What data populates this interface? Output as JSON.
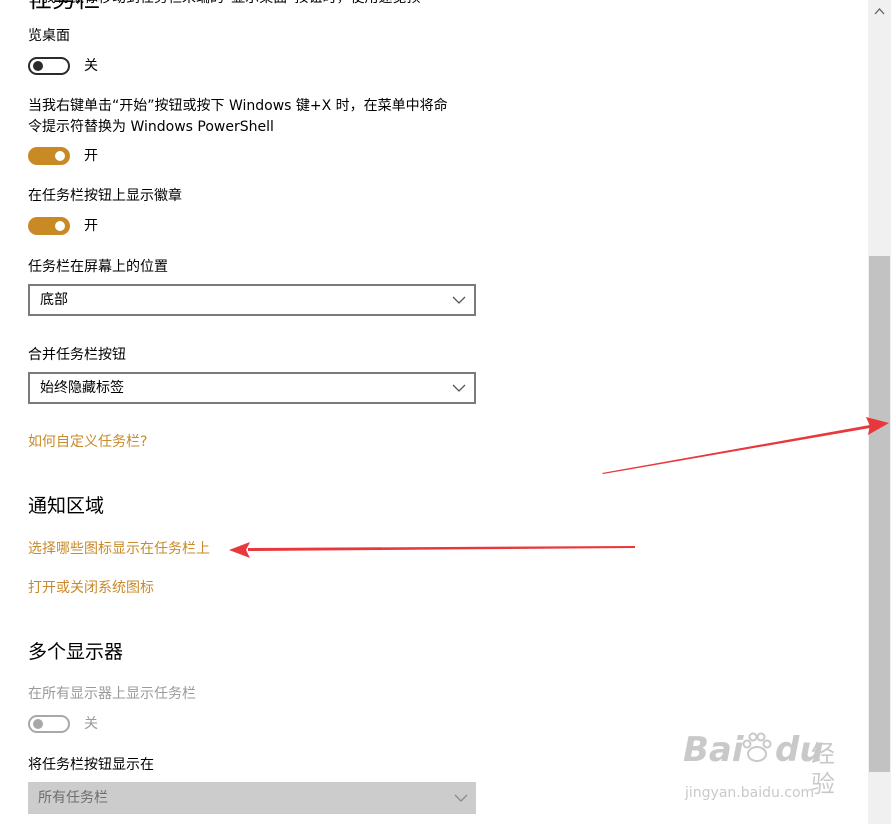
{
  "page": {
    "heading_partial": "任务栏",
    "clipped_line": "当我将鼠标移动到任务栏末端的“显示桌面”按钮时，使用速览预",
    "peek_desktop_label_tail": "览桌面"
  },
  "toggles": {
    "peek": {
      "state": "关"
    },
    "powershell": {
      "label_line1": "当我右键单击“开始”按钮或按下 Windows 键+X 时，在菜单中将命",
      "label_line2": "令提示符替换为 Windows PowerShell",
      "state": "开"
    },
    "badges": {
      "label": "在任务栏按钮上显示徽章",
      "state": "开"
    }
  },
  "position": {
    "label": "任务栏在屏幕上的位置",
    "value": "底部"
  },
  "combine": {
    "label": "合并任务栏按钮",
    "value": "始终隐藏标签"
  },
  "customize_link": "如何自定义任务栏?",
  "notification": {
    "title": "通知区域",
    "link1": "选择哪些图标显示在任务栏上",
    "link2": "打开或关闭系统图标"
  },
  "multi_display": {
    "title": "多个显示器",
    "show_all_label": "在所有显示器上显示任务栏",
    "show_all_state": "关",
    "buttons_label": "将任务栏按钮显示在",
    "buttons_value": "所有任务栏"
  },
  "watermark": {
    "brand": "Bai",
    "brand2": "du",
    "text_cn": "经验",
    "url": "jingyan.baidu.com"
  },
  "colors": {
    "accent": "#c98a26",
    "link": "#c88a2a",
    "annotation_arrow": "#e8383d",
    "scrollbar_thumb": "#c2c2c2"
  },
  "icons": [
    "chevron-down-icon",
    "scroll-up-arrow-icon",
    "paw-icon",
    "red-arrow-annotation"
  ]
}
